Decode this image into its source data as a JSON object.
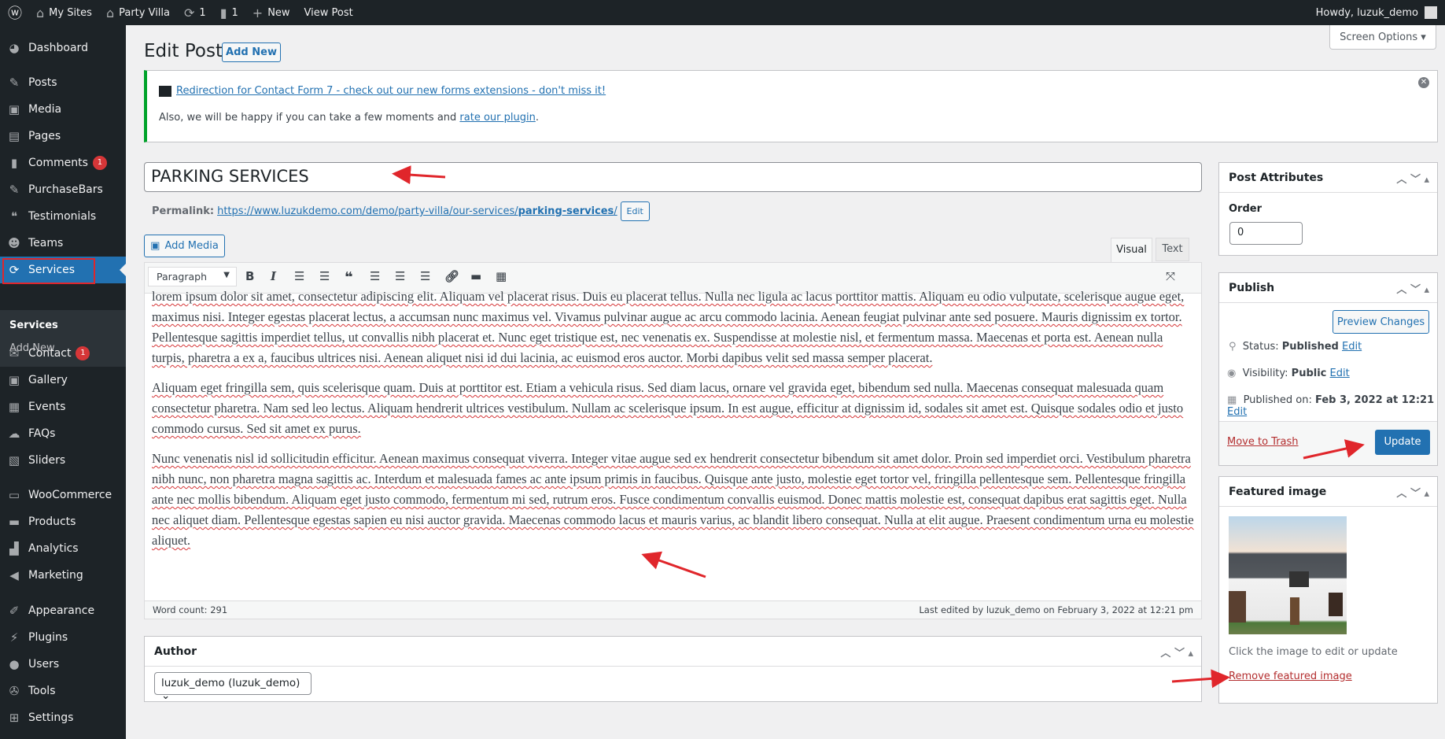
{
  "adminbar": {
    "my_sites": "My Sites",
    "site": "Party Villa",
    "updates": "1",
    "comments": "1",
    "new": "New",
    "view_post": "View Post",
    "howdy": "Howdy, luzuk_demo"
  },
  "sidebar": {
    "items": [
      {
        "label": "Dashboard",
        "icon": "dashboard-icon",
        "glyph": "◕"
      },
      {
        "label": "Posts",
        "icon": "pin-icon",
        "glyph": "✎"
      },
      {
        "label": "Media",
        "icon": "media-icon",
        "glyph": "▣"
      },
      {
        "label": "Pages",
        "icon": "pages-icon",
        "glyph": "▤"
      },
      {
        "label": "Comments",
        "icon": "comment-icon",
        "glyph": "▮",
        "badge": "1"
      },
      {
        "label": "PurchaseBars",
        "icon": "pin-icon",
        "glyph": "✎"
      },
      {
        "label": "Testimonials",
        "icon": "testimonials-icon",
        "glyph": "❝"
      },
      {
        "label": "Teams",
        "icon": "teams-icon",
        "glyph": "☻"
      },
      {
        "label": "Services",
        "icon": "update-icon",
        "glyph": "⟳",
        "current": true
      },
      {
        "label": "Contact",
        "icon": "mail-icon",
        "glyph": "✉",
        "badge": "1"
      },
      {
        "label": "Gallery",
        "icon": "gallery-icon",
        "glyph": "▣"
      },
      {
        "label": "Events",
        "icon": "events-icon",
        "glyph": "▦"
      },
      {
        "label": "FAQs",
        "icon": "faq-icon",
        "glyph": "☁"
      },
      {
        "label": "Sliders",
        "icon": "slides-icon",
        "glyph": "▧"
      },
      {
        "label": "WooCommerce",
        "icon": "woo-icon",
        "glyph": "▭"
      },
      {
        "label": "Products",
        "icon": "archive-icon",
        "glyph": "▬"
      },
      {
        "label": "Analytics",
        "icon": "chart-icon",
        "glyph": "▟"
      },
      {
        "label": "Marketing",
        "icon": "megaphone-icon",
        "glyph": "◀"
      },
      {
        "label": "Appearance",
        "icon": "brush-icon",
        "glyph": "✐"
      },
      {
        "label": "Plugins",
        "icon": "plugin-icon",
        "glyph": "⚡"
      },
      {
        "label": "Users",
        "icon": "user-icon",
        "glyph": "●"
      },
      {
        "label": "Tools",
        "icon": "wrench-icon",
        "glyph": "✇"
      },
      {
        "label": "Settings",
        "icon": "settings-icon",
        "glyph": "⊞"
      }
    ],
    "submenu": [
      "Services",
      "Add New"
    ]
  },
  "header": {
    "title": "Edit Post",
    "add_new": "Add New",
    "screen_options": "Screen Options"
  },
  "notice": {
    "link": "Redirection for Contact Form 7 - check out our new forms extensions - don't miss it!",
    "text": "Also, we will be happy if you can take a few moments and ",
    "rate_link": "rate our plugin",
    "end": "."
  },
  "post": {
    "title": "PARKING SERVICES",
    "permalink_label": "Permalink:",
    "permalink_base": "https://www.luzukdemo.com/demo/party-villa/our-services/",
    "permalink_slug": "parking-services",
    "permalink_end": "/",
    "edit": "Edit"
  },
  "editor": {
    "add_media": "Add Media",
    "tab_visual": "Visual",
    "tab_text": "Text",
    "format": "Paragraph",
    "paragraphs": [
      "lorem ipsum dolor sit amet, consectetur adipiscing elit. Aliquam vel placerat risus. Duis eu placerat tellus. Nulla nec ligula ac lacus porttitor mattis. Aliquam eu odio vulputate, scelerisque augue eget, maximus nisi. Integer egestas placerat lectus, a accumsan nunc maximus vel. Vivamus pulvinar augue ac arcu commodo lacinia. Aenean feugiat pulvinar ante sed posuere. Mauris dignissim ex tortor. Pellentesque sagittis imperdiet tellus, ut convallis nibh placerat et. Nunc eget tristique est, nec venenatis ex. Suspendisse at molestie nisl, et fermentum massa. Maecenas et porta est. Aenean nulla turpis, pharetra a ex a, faucibus ultrices nisi. Aenean aliquet nisi id dui lacinia, ac euismod eros auctor. Morbi dapibus velit sed massa semper placerat.",
      "Aliquam eget fringilla sem, quis scelerisque quam. Duis at porttitor est. Etiam a vehicula risus. Sed diam lacus, ornare vel gravida eget, bibendum sed nulla. Maecenas consequat malesuada quam consectetur pharetra. Nam sed leo lectus. Aliquam hendrerit ultrices vestibulum. Nullam ac scelerisque ipsum. In est augue, efficitur at dignissim id, sodales sit amet est. Quisque sodales odio et justo commodo cursus. Sed sit amet ex purus.",
      "Nunc venenatis nisl id sollicitudin efficitur. Aenean maximus consequat viverra. Integer vitae augue sed ex hendrerit consectetur bibendum sit amet dolor. Proin sed imperdiet orci. Vestibulum pharetra nibh nunc, non pharetra magna sagittis ac. Interdum et malesuada fames ac ante ipsum primis in faucibus. Quisque ante justo, molestie eget tortor vel, fringilla pellentesque sem. Pellentesque fringilla ante nec mollis bibendum. Aliquam eget justo commodo, fermentum mi sed, rutrum eros. Fusce condimentum convallis euismod. Donec mattis molestie est, consequat dapibus erat sagittis eget. Nulla nec aliquet diam. Pellentesque egestas sapien eu nisi auctor gravida. Maecenas commodo lacus et mauris varius, ac blandit libero consequat. Nulla at elit augue. Praesent condimentum urna eu molestie aliquet."
    ],
    "word_count": "Word count: 291",
    "last_edited": "Last edited by luzuk_demo on February 3, 2022 at 12:21 pm"
  },
  "author": {
    "title": "Author",
    "value": "luzuk_demo (luzuk_demo)"
  },
  "attributes": {
    "title": "Post Attributes",
    "order_label": "Order",
    "order_value": "0"
  },
  "publish": {
    "title": "Publish",
    "preview": "Preview Changes",
    "status_label": "Status: ",
    "status": "Published",
    "visibility_label": "Visibility: ",
    "visibility": "Public",
    "published_label": "Published on: ",
    "published": "Feb 3, 2022 at 12:21",
    "edit": "Edit",
    "trash": "Move to Trash",
    "update": "Update"
  },
  "featured": {
    "title": "Featured image",
    "hint": "Click the image to edit or update",
    "remove": "Remove featured image"
  },
  "colors": {
    "accent": "#2271b1",
    "sidebar": "#1d2327",
    "annotation": "#e0262b"
  }
}
